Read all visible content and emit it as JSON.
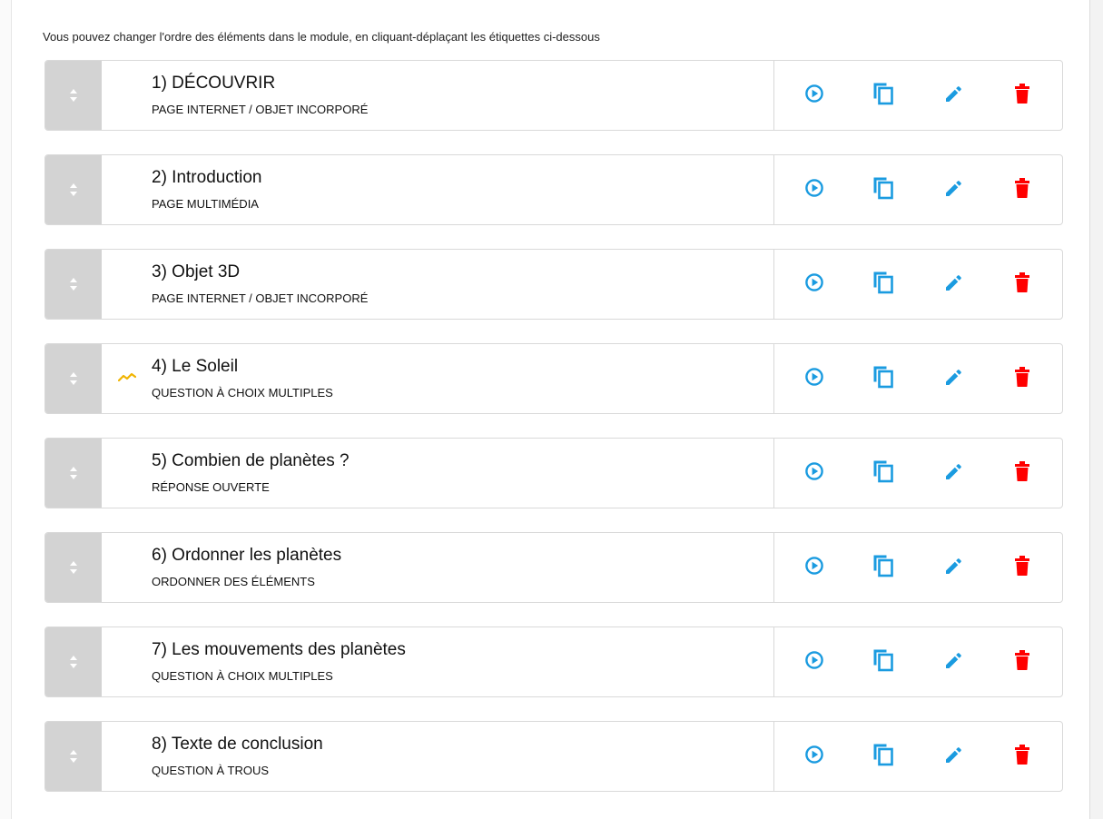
{
  "instruction": "Vous pouvez changer l'ordre des éléments dans le module, en cliquant-déplaçant les étiquettes ci-dessous",
  "colors": {
    "accent": "#1a9be0",
    "delete": "#ff0000",
    "handle": "#d3d3d3",
    "stats": "#f0b400"
  },
  "icons": [
    "sort-icon",
    "play-icon",
    "duplicate-icon",
    "edit-icon",
    "delete-icon",
    "stats-icon"
  ],
  "items": [
    {
      "title": "1) DÉCOUVRIR",
      "type": "PAGE INTERNET / OBJET INCORPORÉ"
    },
    {
      "title": "2) Introduction",
      "type": "PAGE MULTIMÉDIA"
    },
    {
      "title": "3) Objet 3D",
      "type": "PAGE INTERNET / OBJET INCORPORÉ"
    },
    {
      "title": "4) Le Soleil",
      "type": "QUESTION À CHOIX MULTIPLES",
      "stats": true
    },
    {
      "title": "5) Combien de planètes ?",
      "type": "RÉPONSE OUVERTE"
    },
    {
      "title": "6) Ordonner les planètes",
      "type": "ORDONNER DES ÉLÉMENTS"
    },
    {
      "title": "7) Les mouvements des planètes",
      "type": "QUESTION À CHOIX MULTIPLES"
    },
    {
      "title": "8) Texte de conclusion",
      "type": "QUESTION À TROUS"
    }
  ]
}
